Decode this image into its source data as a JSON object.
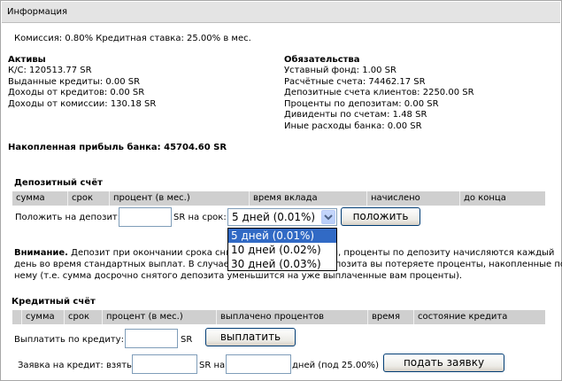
{
  "header": {
    "title": "Информация"
  },
  "rates": {
    "text": "Комиссия: 0.80%   Кредитная ставка: 25.00% в мес."
  },
  "assets": {
    "title": "Активы",
    "items": [
      "К/С: 120513.77 SR",
      "Выданные кредиты: 0.00 SR",
      "Доходы от кредитов: 0.00 SR",
      "Доходы от комиссии: 130.18 SR"
    ]
  },
  "liabilities": {
    "title": "Обязательства",
    "items": [
      "Уставный фонд: 1.00 SR",
      "Расчётные счета: 74462.17 SR",
      "Депозитные счета клиентов: 2250.00 SR",
      "Проценты по депозитам: 0.00 SR",
      "Дивиденты по счетам: 1.48 SR",
      "Иные расходы банка: 0.00 SR"
    ]
  },
  "profit": {
    "text": "Накопленная прибыль банка: 45704.60 SR"
  },
  "deposit": {
    "title": "Депозитный счёт",
    "columns": [
      "сумма",
      "срок",
      "процент (в мес.)",
      "время вклада",
      "начислено",
      "до конца"
    ],
    "put_label": "Положить на депозит:",
    "term_label": "SR на срок:",
    "amount_value": "",
    "term_selected": "5 дней (0.01%)",
    "term_options": [
      "5 дней (0.01%)",
      "10 дней (0.02%)",
      "30 дней (0.03%)"
    ],
    "submit_label": "положить",
    "warning_bold": "Внимание.",
    "warning_line1": "Депозит при окончании срока снимается автоматически, проценты по депозиту начисляются каждый",
    "warning_line2": "день во время стандартных выплат. В случае досрочного снятия депозита вы потеряете проценты, накопленные по",
    "warning_line3": "нему (т.е. сумма досрочно снятого депозита уменьшится на уже выплаченные вам проценты)."
  },
  "credit": {
    "title": "Кредитный счёт",
    "columns": [
      "сумма",
      "срок",
      "процент (в мес.)",
      "выплачено процентов",
      "время",
      "состояние кредита"
    ],
    "pay_label": "Выплатить по кредиту:",
    "pay_unit": "SR",
    "pay_value": "",
    "pay_button": "выплатить",
    "request_prefix": "Заявка на кредит: взять",
    "request_mid": "SR на",
    "request_suffix": "дней (под 25.00%)",
    "amount_value": "",
    "days_value": "",
    "request_button": "подать заявку"
  }
}
